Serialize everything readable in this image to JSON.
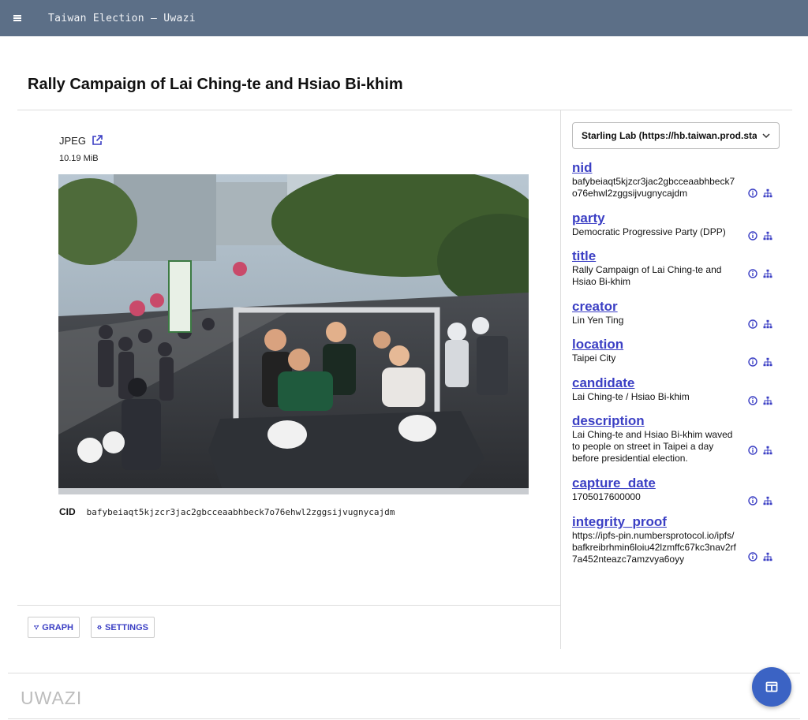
{
  "app": {
    "title": "Taiwan Election — Uwazi"
  },
  "entity": {
    "title": "Rally Campaign of Lai Ching-te and Hsiao Bi-khim"
  },
  "file": {
    "type": "JPEG",
    "size": "10.19 MiB",
    "cid_label": "CID",
    "cid": "bafybeiaqt5kjzcr3jac2gbcceaabhbeck7o76ehwl2zggsijvugnycajdm"
  },
  "buttons": {
    "graph": "GRAPH",
    "settings": "SETTINGS"
  },
  "source_select": {
    "selected": "Starling Lab (https://hb.taiwan.prod.starlinglab.org)"
  },
  "metadata": [
    {
      "key": "nid",
      "value": "bafybeiaqt5kjzcr3jac2gbcceaabhbeck7o76ehwl2zggsijvugnycajdm"
    },
    {
      "key": "party",
      "value": "Democratic Progressive Party (DPP)"
    },
    {
      "key": "title",
      "value": "Rally Campaign of Lai Ching-te and Hsiao Bi-khim"
    },
    {
      "key": "creator",
      "value": "Lin Yen Ting"
    },
    {
      "key": "location",
      "value": "Taipei City"
    },
    {
      "key": "candidate",
      "value": "Lai Ching-te / Hsiao Bi-khim"
    },
    {
      "key": "description",
      "value": "Lai Ching-te and Hsiao Bi-khim waved to people on street in Taipei a day before presidential election."
    },
    {
      "key": "capture_date",
      "value": "1705017600000"
    },
    {
      "key": "integrity_proof",
      "value": "https://ipfs-pin.numbersprotocol.io/ipfs/bafkreibrhmin6loiu42lzmffc67kc3nav2rf7a452nteazc7amzvya6oyy"
    }
  ],
  "footer": {
    "logo": "UWAZI"
  },
  "colors": {
    "topbar": "#5c6f87",
    "accent": "#3b3fc4",
    "fab": "#3b63c4"
  },
  "icons": {
    "menu": "hamburger-icon",
    "external": "external-link-icon",
    "graph": "graph-icon",
    "settings": "gear-icon",
    "info": "info-icon",
    "relations": "sitemap-icon",
    "fab": "sidepanel-icon"
  }
}
